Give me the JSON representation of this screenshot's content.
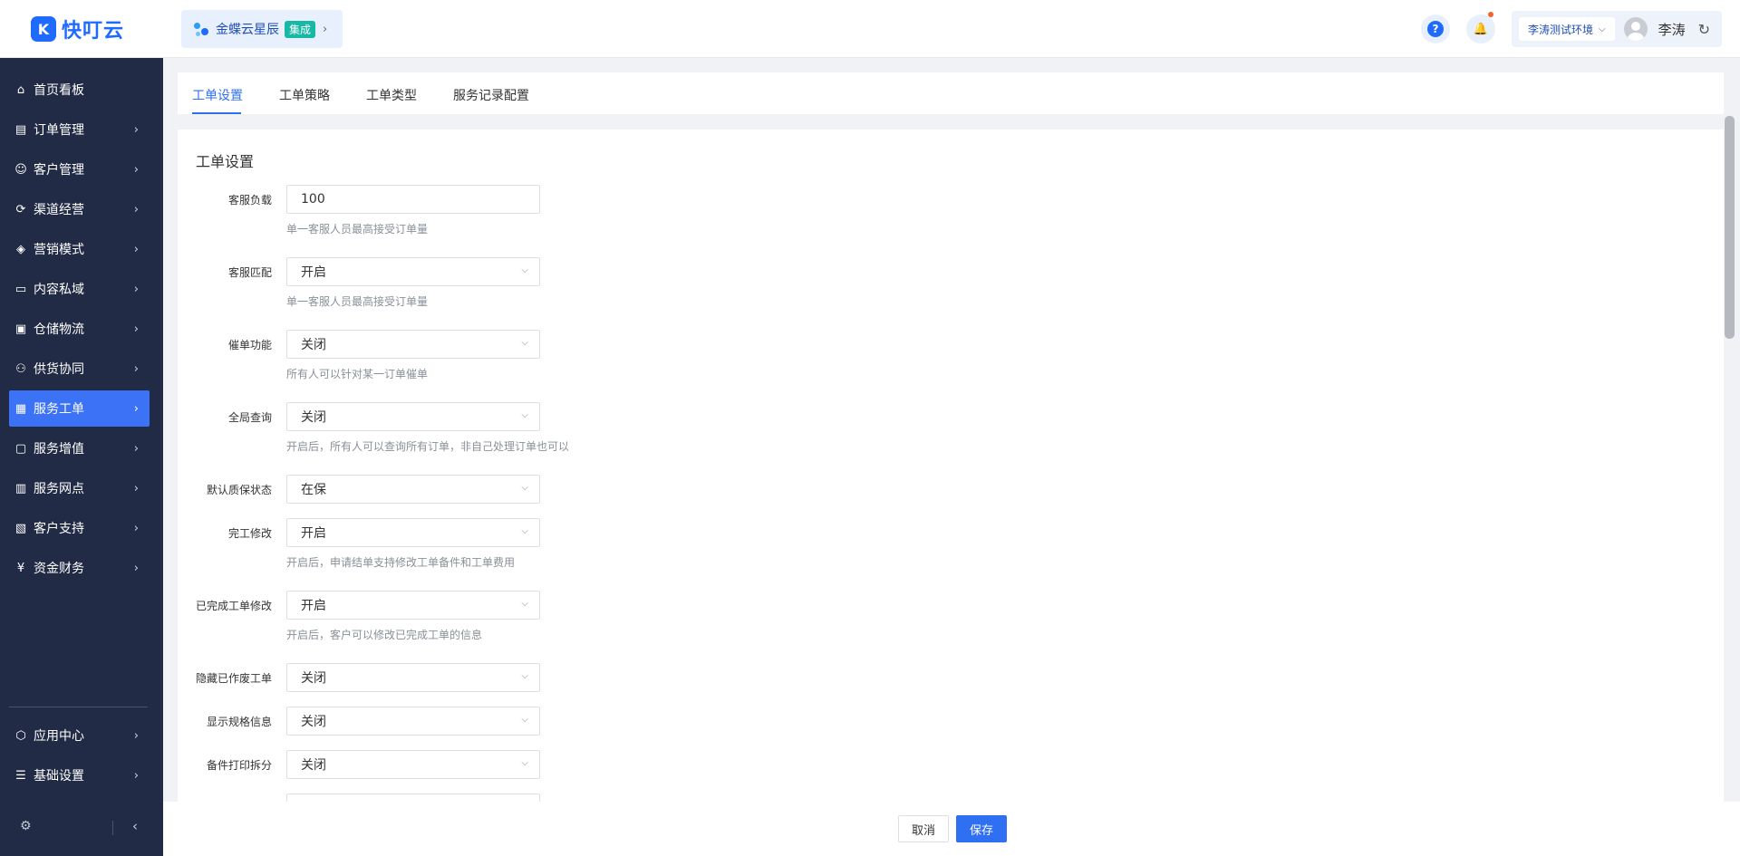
{
  "header": {
    "logo_mark": "K",
    "logo_text": "快叮云",
    "integration_name": "金蝶云星辰",
    "integration_badge": "集成",
    "integration_arrow": "›",
    "help_icon": "?",
    "bell_icon": "🔔",
    "environment": "李涛测试环境",
    "environment_chevron": "⌵",
    "user_name": "李涛",
    "refresh_icon": "↻"
  },
  "sidebar": {
    "items": [
      {
        "label": "首页看板",
        "icon": "⌂",
        "arrow": ""
      },
      {
        "label": "订单管理",
        "icon": "▤",
        "arrow": "›"
      },
      {
        "label": "客户管理",
        "icon": "☺",
        "arrow": "›"
      },
      {
        "label": "渠道经营",
        "icon": "⟳",
        "arrow": "›"
      },
      {
        "label": "营销模式",
        "icon": "◈",
        "arrow": "›"
      },
      {
        "label": "内容私域",
        "icon": "▭",
        "arrow": "›"
      },
      {
        "label": "仓储物流",
        "icon": "▣",
        "arrow": "›"
      },
      {
        "label": "供货协同",
        "icon": "⚇",
        "arrow": "›"
      },
      {
        "label": "服务工单",
        "icon": "▦",
        "arrow": "›"
      },
      {
        "label": "服务增值",
        "icon": "▢",
        "arrow": "›"
      },
      {
        "label": "服务网点",
        "icon": "▥",
        "arrow": "›"
      },
      {
        "label": "客户支持",
        "icon": "▧",
        "arrow": "›"
      },
      {
        "label": "资金财务",
        "icon": "¥",
        "arrow": "›"
      },
      {
        "label": "应用中心",
        "icon": "⬡",
        "arrow": "›"
      },
      {
        "label": "基础设置",
        "icon": "☰",
        "arrow": "›"
      }
    ],
    "gear_icon": "⚙",
    "collapse_icon": "‹"
  },
  "tabs": [
    {
      "label": "工单设置"
    },
    {
      "label": "工单策略"
    },
    {
      "label": "工单类型"
    },
    {
      "label": "服务记录配置"
    }
  ],
  "settings": {
    "title": "工单设置",
    "dropdown_arrow": "⌵",
    "rows": [
      {
        "label": "客服负载",
        "value": "100",
        "hint": "单一客服人员最高接受订单量"
      },
      {
        "label": "客服匹配",
        "value": "开启",
        "hint": "单一客服人员最高接受订单量"
      },
      {
        "label": "催单功能",
        "value": "关闭",
        "hint": "所有人可以针对某一订单催单"
      },
      {
        "label": "全局查询",
        "value": "关闭",
        "hint": "开启后，所有人可以查询所有订单，非自己处理订单也可以"
      },
      {
        "label": "默认质保状态",
        "value": "在保",
        "hint": ""
      },
      {
        "label": "完工修改",
        "value": "开启",
        "hint": "开启后，申请结单支持修改工单备件和工单费用"
      },
      {
        "label": "已完成工单修改",
        "value": "开启",
        "hint": "开启后，客户可以修改已完成工单的信息"
      },
      {
        "label": "隐藏已作废工单",
        "value": "关闭",
        "hint": ""
      },
      {
        "label": "显示规格信息",
        "value": "关闭",
        "hint": ""
      },
      {
        "label": "备件打印拆分",
        "value": "关闭",
        "hint": ""
      }
    ]
  },
  "footer": {
    "cancel": "取消",
    "save": "保存"
  }
}
